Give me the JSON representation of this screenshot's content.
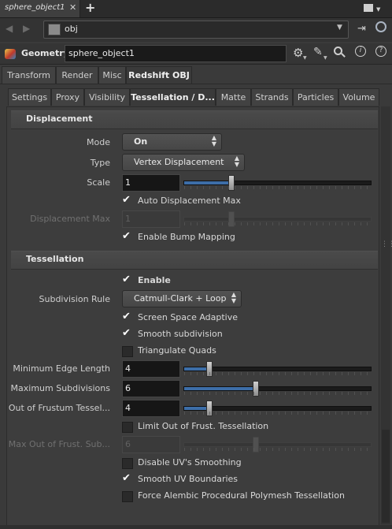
{
  "window": {
    "doc_tab": "sphere_object1",
    "doc_tab_close": "✕",
    "new_tab": "+"
  },
  "navbar": {
    "path": "obj",
    "back": "◀",
    "forward": "▶",
    "dropdown": "▼"
  },
  "header": {
    "node_type": "Geometry",
    "node_name": "sphere_object1",
    "icons": [
      "gear-icon",
      "brush-icon",
      "search-icon",
      "info-icon",
      "help-icon"
    ]
  },
  "tabs_main": [
    "Transform",
    "Render",
    "Misc",
    "Redshift OBJ"
  ],
  "tabs_main_active": "Redshift OBJ",
  "tabs_sub": [
    "Settings",
    "Proxy",
    "Visibility",
    "Tessellation / D...",
    "Matte",
    "Strands",
    "Particles",
    "Volume"
  ],
  "tabs_sub_active": "Tessellation / D...",
  "displacement": {
    "title": "Displacement",
    "mode_label": "Mode",
    "mode_value": "On",
    "type_label": "Type",
    "type_value": "Vertex Displacement",
    "scale_label": "Scale",
    "scale_value": "1",
    "scale_slider": 0.25,
    "auto_disp_label": "Auto Displacement Max",
    "auto_disp_checked": true,
    "disp_max_label": "Displacement Max",
    "disp_max_value": "1",
    "disp_max_slider": 0.25,
    "bump_label": "Enable Bump Mapping",
    "bump_checked": true
  },
  "tessellation": {
    "title": "Tessellation",
    "enable_label": "Enable",
    "enable_checked": true,
    "subdiv_rule_label": "Subdivision Rule",
    "subdiv_rule_value": "Catmull-Clark + Loop",
    "screen_space_label": "Screen Space Adaptive",
    "screen_space_checked": true,
    "smooth_subdiv_label": "Smooth subdivision",
    "smooth_subdiv_checked": true,
    "triangulate_label": "Triangulate Quads",
    "triangulate_checked": false,
    "min_edge_label": "Minimum Edge Length",
    "min_edge_value": "4",
    "min_edge_slider": 0.13,
    "max_subdiv_label": "Maximum Subdivisions",
    "max_subdiv_value": "6",
    "max_subdiv_slider": 0.38,
    "oof_label": "Out of Frustum Tessel...",
    "oof_value": "4",
    "oof_slider": 0.13,
    "limit_oof_label": "Limit Out of Frust. Tessellation",
    "limit_oof_checked": false,
    "max_oof_label": "Max Out of Frust. Sub...",
    "max_oof_value": "6",
    "max_oof_slider": 0.38,
    "disable_uv_label": "Disable UV's Smoothing",
    "disable_uv_checked": false,
    "smooth_uv_label": "Smooth UV Boundaries",
    "smooth_uv_checked": true,
    "force_alembic_label": "Force Alembic Procedural Polymesh Tessellation",
    "force_alembic_checked": false
  },
  "colors": {
    "accent_blue": "#3d6ea8",
    "background": "#3a3a3a"
  }
}
